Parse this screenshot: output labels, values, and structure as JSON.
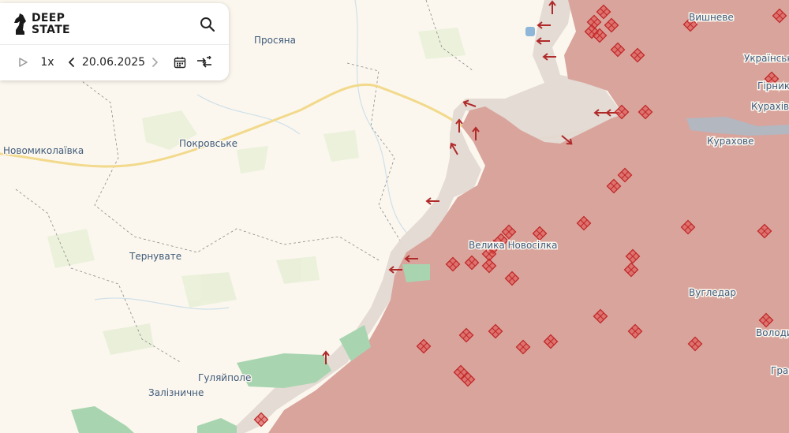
{
  "app": {
    "logo_line1": "DEEP",
    "logo_line2": "STATE"
  },
  "toolbar": {
    "speed_label": "1x",
    "date_label": "20.06.2025",
    "icons": [
      "play-icon",
      "chevron-left-icon",
      "chevron-right-icon",
      "calendar-icon",
      "compare-arrows-icon"
    ]
  },
  "search": {
    "icon": "search-icon"
  },
  "map": {
    "colors": {
      "background": "#fbf7ee",
      "occupied": "#d9a49c",
      "contested": "#e2d9d2",
      "liberated": "#a8d5b0",
      "road": "#f2d98b",
      "marker": "#e04848"
    },
    "places": [
      {
        "name": "Просяна"
      },
      {
        "name": "Вишневе"
      },
      {
        "name": "Український"
      },
      {
        "name": "Гірник"
      },
      {
        "name": "Курахівка"
      },
      {
        "name": "Новомиколаївка"
      },
      {
        "name": "Покровське"
      },
      {
        "name": "Курахове"
      },
      {
        "name": "Велика Новосілка"
      },
      {
        "name": "Тернувате"
      },
      {
        "name": "Вугледар"
      },
      {
        "name": "Володимирівка"
      },
      {
        "name": "Гуляйполе"
      },
      {
        "name": "Залізничне"
      },
      {
        "name": "Графське"
      }
    ]
  }
}
